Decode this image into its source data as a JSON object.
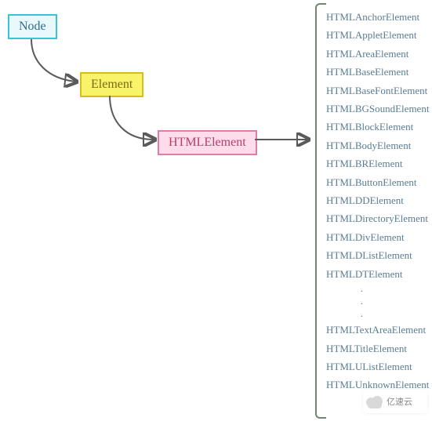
{
  "boxes": {
    "node": "Node",
    "element": "Element",
    "htmlelement": "HTMLElement"
  },
  "list_before_dots": [
    "HTMLAnchorElement",
    "HTMLAppletElement",
    "HTMLAreaElement",
    "HTMLBaseElement",
    "HTMLBaseFontElement",
    "HTMLBGSoundElement",
    "HTMLBlockElement",
    "HTMLBodyElement",
    "HTMLBRElement",
    "HTMLButtonElement",
    "HTMLDDElement",
    "HTMLDirectoryElement",
    "HTMLDivElement",
    "HTMLDListElement",
    "HTMLDTElement"
  ],
  "list_after_dots": [
    "HTMLTextAreaElement",
    "HTMLTitleElement",
    "HTMLUListElement",
    "HTMLUnknownElement"
  ],
  "watermark_text": "亿速云"
}
